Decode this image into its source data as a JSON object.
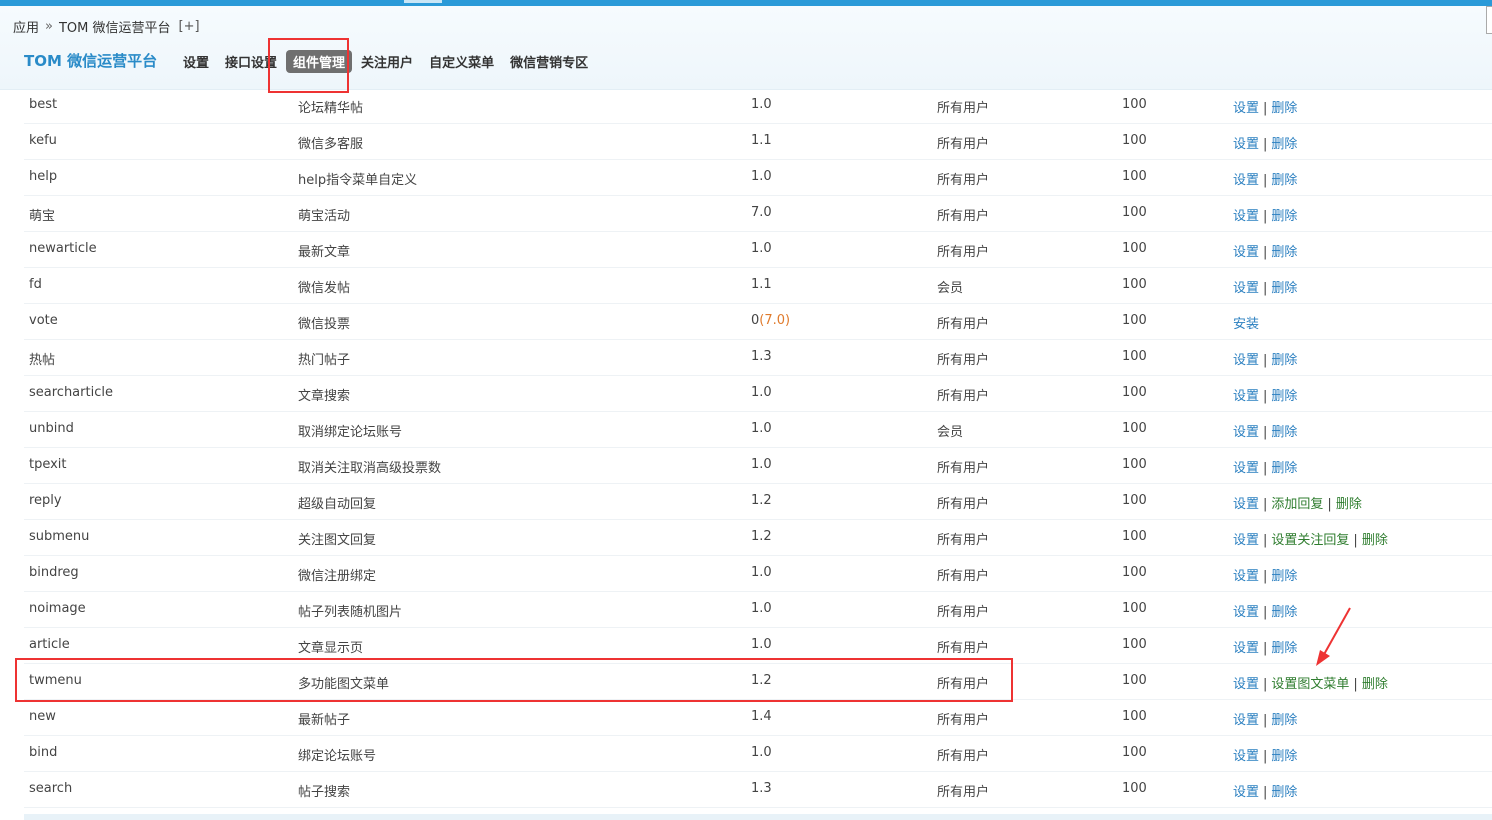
{
  "breadcrumb": {
    "root": "应用",
    "sep": "»",
    "current": "TOM 微信运营平台",
    "add": "[+]"
  },
  "brand": "TOM 微信运营平台",
  "nav": [
    {
      "label": "设置",
      "active": false
    },
    {
      "label": "接口设置",
      "active": false
    },
    {
      "label": "组件管理",
      "active": true
    },
    {
      "label": "关注用户",
      "active": false
    },
    {
      "label": "自定义菜单",
      "active": false
    },
    {
      "label": "微信营销专区",
      "active": false
    }
  ],
  "rows": [
    {
      "key": "best",
      "name": "论坛精华帖",
      "version": "1.0",
      "users": "所有用户",
      "num": "100",
      "ops": [
        "设置",
        "删除"
      ]
    },
    {
      "key": "kefu",
      "name": "微信多客服",
      "version": "1.1",
      "users": "所有用户",
      "num": "100",
      "ops": [
        "设置",
        "删除"
      ]
    },
    {
      "key": "help",
      "name": "help指令菜单自定义",
      "version": "1.0",
      "users": "所有用户",
      "num": "100",
      "ops": [
        "设置",
        "删除"
      ]
    },
    {
      "key": "萌宝",
      "name": "萌宝活动",
      "version": "7.0",
      "users": "所有用户",
      "num": "100",
      "ops": [
        "设置",
        "删除"
      ]
    },
    {
      "key": "newarticle",
      "name": "最新文章",
      "version": "1.0",
      "users": "所有用户",
      "num": "100",
      "ops": [
        "设置",
        "删除"
      ]
    },
    {
      "key": "fd",
      "name": "微信发帖",
      "version": "1.1",
      "users": "会员",
      "num": "100",
      "ops": [
        "设置",
        "删除"
      ]
    },
    {
      "key": "vote",
      "name": "微信投票",
      "version": "0",
      "version_new": "(7.0)",
      "users": "所有用户",
      "num": "100",
      "ops": [
        "安装"
      ]
    },
    {
      "key": "热帖",
      "name": "热门帖子",
      "version": "1.3",
      "users": "所有用户",
      "num": "100",
      "ops": [
        "设置",
        "删除"
      ]
    },
    {
      "key": "searcharticle",
      "name": "文章搜索",
      "version": "1.0",
      "users": "所有用户",
      "num": "100",
      "ops": [
        "设置",
        "删除"
      ]
    },
    {
      "key": "unbind",
      "name": "取消绑定论坛账号",
      "version": "1.0",
      "users": "会员",
      "num": "100",
      "ops": [
        "设置",
        "删除"
      ]
    },
    {
      "key": "tpexit",
      "name": "取消关注取消高级投票数",
      "version": "1.0",
      "users": "所有用户",
      "num": "100",
      "ops": [
        "设置",
        "删除"
      ]
    },
    {
      "key": "reply",
      "name": "超级自动回复",
      "version": "1.2",
      "users": "所有用户",
      "num": "100",
      "ops": [
        "设置",
        "添加回复",
        "删除"
      ]
    },
    {
      "key": "submenu",
      "name": "关注图文回复",
      "version": "1.2",
      "users": "所有用户",
      "num": "100",
      "ops": [
        "设置",
        "设置关注回复",
        "删除"
      ]
    },
    {
      "key": "bindreg",
      "name": "微信注册绑定",
      "version": "1.0",
      "users": "所有用户",
      "num": "100",
      "ops": [
        "设置",
        "删除"
      ]
    },
    {
      "key": "noimage",
      "name": "帖子列表随机图片",
      "version": "1.0",
      "users": "所有用户",
      "num": "100",
      "ops": [
        "设置",
        "删除"
      ]
    },
    {
      "key": "article",
      "name": "文章显示页",
      "version": "1.0",
      "users": "所有用户",
      "num": "100",
      "ops": [
        "设置",
        "删除"
      ]
    },
    {
      "key": "twmenu",
      "name": "多功能图文菜单",
      "version": "1.2",
      "users": "所有用户",
      "num": "100",
      "ops": [
        "设置",
        "设置图文菜单",
        "删除"
      ]
    },
    {
      "key": "new",
      "name": "最新帖子",
      "version": "1.4",
      "users": "所有用户",
      "num": "100",
      "ops": [
        "设置",
        "删除"
      ]
    },
    {
      "key": "bind",
      "name": "绑定论坛账号",
      "version": "1.0",
      "users": "所有用户",
      "num": "100",
      "ops": [
        "设置",
        "删除"
      ]
    },
    {
      "key": "search",
      "name": "帖子搜索",
      "version": "1.3",
      "users": "所有用户",
      "num": "100",
      "ops": [
        "设置",
        "删除"
      ]
    }
  ],
  "colors": {
    "accent": "#2a9ad8",
    "link": "#2a7fc0",
    "link_alt": "#2f7d2f",
    "version_new": "#e07b2d",
    "highlight": "#e33333"
  }
}
